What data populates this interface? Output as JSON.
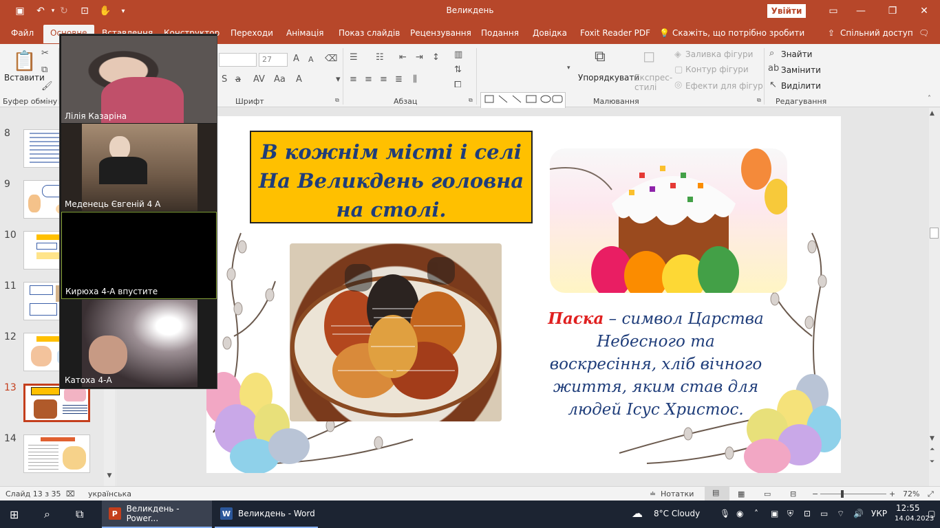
{
  "titlebar": {
    "title": "Великдень",
    "signin": "Увійти",
    "min_icon": "minimize-icon",
    "restore_icon": "restore-icon",
    "close_icon": "close-icon",
    "accent": "#b7472a"
  },
  "tabs": [
    {
      "label": "Файл"
    },
    {
      "label": "Основне"
    },
    {
      "label": "Вставлення"
    },
    {
      "label": "Конструктор"
    },
    {
      "label": "Переходи"
    },
    {
      "label": "Анімація"
    },
    {
      "label": "Показ слайдів"
    },
    {
      "label": "Рецензування"
    },
    {
      "label": "Подання"
    },
    {
      "label": "Довідка"
    },
    {
      "label": "Foxit Reader PDF"
    }
  ],
  "tellme": "Скажіть, що потрібно зробити",
  "share": "Спільний доступ",
  "ribbon": {
    "paste": "Вставити",
    "clipboard": "Буфер обміну",
    "font_size": "27",
    "font_group": "Шрифт",
    "paragraph": "Абзац",
    "arrange": "Упорядкувати",
    "quick_styles": "Експрес-стилі",
    "shape_fill": "Заливка фігури",
    "shape_outline": "Контур фігури",
    "shape_effects": "Ефекти для фігур",
    "drawing": "Малювання",
    "find": "Знайти",
    "replace": "Замінити",
    "select": "Виділити",
    "editing": "Редагування"
  },
  "slides": [
    {
      "num": "8"
    },
    {
      "num": "9"
    },
    {
      "num": "10"
    },
    {
      "num": "11"
    },
    {
      "num": "12"
    },
    {
      "num": "13"
    },
    {
      "num": "14"
    }
  ],
  "slide": {
    "headline_1": "В кожнім місті і селі",
    "headline_2": "На Великдень головна",
    "headline_3": "на столі.",
    "quote_red": "Паска",
    "quote_rest": " – символ Царства Небесного та воскресіння, хліб вічного життя, яким став для людей Ісус Христос."
  },
  "participants": [
    {
      "name": "Лілія Казаріна"
    },
    {
      "name": "Меденець Євгеній 4 А"
    },
    {
      "name": "Кирюха 4-А впустите"
    },
    {
      "name": "Катоха 4-А"
    }
  ],
  "status": {
    "slide_count": "Слайд 13 з 35",
    "language": "українська",
    "notes": "Нотатки",
    "zoom": "72%"
  },
  "taskbar": {
    "app1": "Великдень - Power...",
    "app2": "Великдень - Word",
    "weather": "8°C  Cloudy",
    "lang": "УКР",
    "time": "12:55",
    "date": "14.04.2023"
  }
}
